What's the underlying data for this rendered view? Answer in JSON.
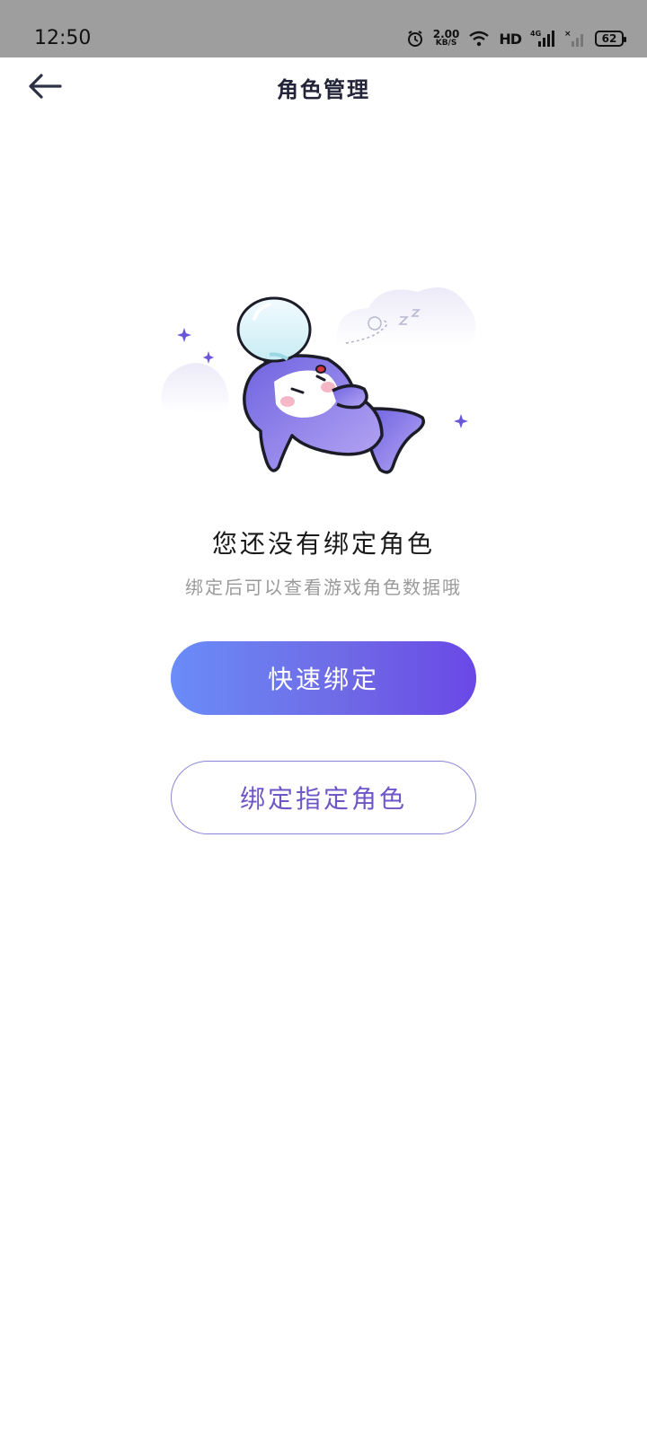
{
  "status_bar": {
    "time": "12:50",
    "net_speed_value": "2.00",
    "net_speed_unit": "KB/S",
    "hd_label": "HD",
    "signal_label": "4G",
    "battery_level": "62",
    "icons": [
      "alarm-icon",
      "wifi-icon",
      "signal-icon",
      "battery-icon"
    ]
  },
  "header": {
    "title": "角色管理",
    "back_icon": "back-arrow-icon"
  },
  "empty_state": {
    "illustration": "sleeping-penguin-illustration",
    "title": "您还没有绑定角色",
    "subtitle": "绑定后可以查看游戏角色数据哦"
  },
  "actions": {
    "quick_bind_label": "快速绑定",
    "bind_specific_label": "绑定指定角色"
  },
  "colors": {
    "accent": "#6a48e6",
    "gradient_start": "#6a8cf8",
    "secondary_text": "#6e55c8",
    "outline": "#8c86d8"
  }
}
